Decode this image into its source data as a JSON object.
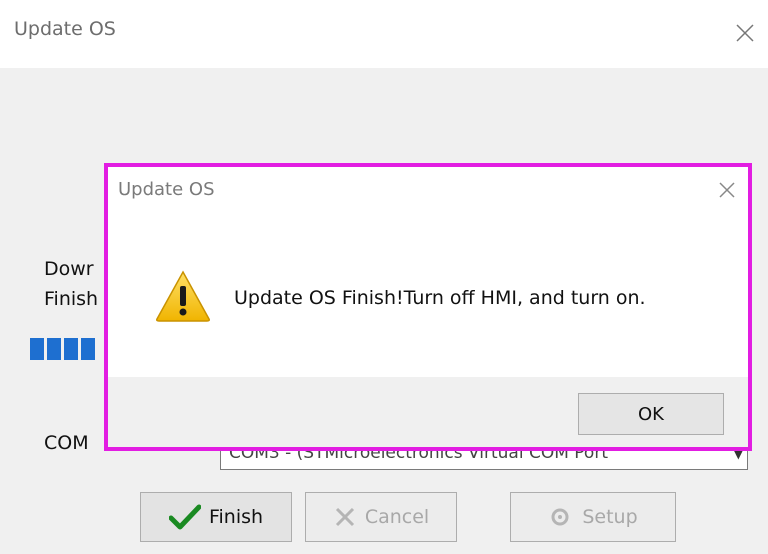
{
  "background_window": {
    "title": "Update OS",
    "download_label": "Dowr",
    "finish_label": "Finish",
    "com_label": "COM",
    "com_value": "COM3 - (STMicroelectronics Virtual COM Port",
    "buttons": {
      "finish": "Finish",
      "cancel": "Cancel",
      "setup": "Setup"
    }
  },
  "dialog": {
    "title": "Update OS",
    "message": "Update OS Finish!Turn off HMI, and turn on.",
    "ok_label": "OK",
    "highlight_color": "#e21de2"
  },
  "icons": {
    "close": "close-icon",
    "warning": "warning-icon",
    "checkmark": "checkmark-icon",
    "cancel": "cancel-icon",
    "setup": "setup-icon"
  },
  "progress": {
    "segments_visible": 4
  }
}
